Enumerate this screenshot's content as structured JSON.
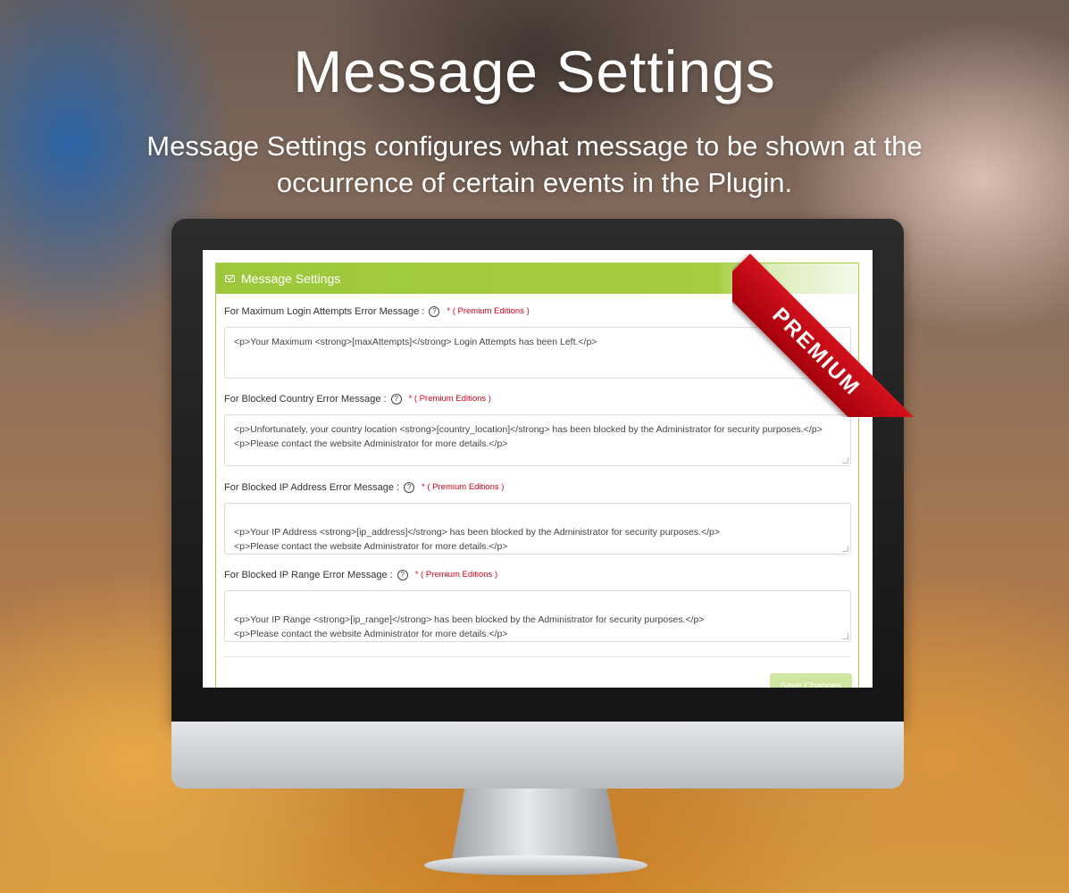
{
  "hero": {
    "title": "Message Settings",
    "subtitle": "Message Settings configures what message to be shown at the occurrence of certain events in the Plugin."
  },
  "ribbon": {
    "label": "PREMIUM"
  },
  "panel": {
    "title": "Message Settings",
    "icon": "mail-icon",
    "accent_color": "#9dc83b"
  },
  "fields": [
    {
      "label": "For Maximum Login Attempts Error Message :",
      "note": "* ( Premium Editions )",
      "value": "<p>Your Maximum <strong>[maxAttempts]</strong> Login Attempts has been Left.</p>"
    },
    {
      "label": "For Blocked Country Error Message :",
      "note": "* ( Premium Editions )",
      "value": "<p>Unfortunately, your country location <strong>[country_location]</strong> has been blocked by the Administrator for security purposes.</p><p>Please contact the website Administrator for more details.</p>"
    },
    {
      "label": "For Blocked IP Address Error Message :",
      "note": "* ( Premium Editions )",
      "value": "<p>Your IP Address <strong>[ip_address]</strong> has been blocked by the Administrator for security purposes.</p>\n<p>Please contact the website Administrator for more details.</p>"
    },
    {
      "label": "For Blocked IP Range Error Message :",
      "note": "* ( Premium Editions )",
      "value": "<p>Your IP Range <strong>[ip_range]</strong> has been blocked by the Administrator for security purposes.</p>\n<p>Please contact the website Administrator for more details.</p>"
    }
  ],
  "save_button": {
    "label": "Save Changes"
  }
}
